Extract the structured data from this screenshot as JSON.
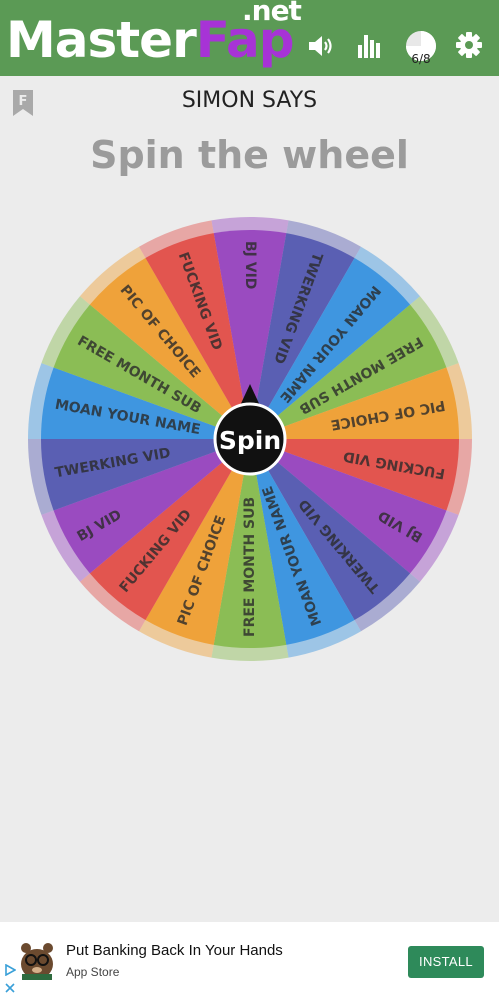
{
  "header": {
    "logo_master": "Master",
    "logo_fap": "Fap",
    "logo_net": ".net",
    "progress_label": "6/8",
    "icons": [
      "volume-icon",
      "bar-chart-icon",
      "progress-pie-icon",
      "gear-icon"
    ],
    "color": "#5b9a55"
  },
  "page": {
    "bookmark_letter": "F",
    "subtitle": "SIMON SAYS",
    "title": "Spin the wheel"
  },
  "wheel": {
    "center_label": "Spin",
    "segments": [
      "BJ VID",
      "TWERKING VID",
      "MOAN YOUR NAME",
      "FREE MONTH SUB",
      "PIC OF CHOICE",
      "FUCKING VID",
      "BJ VID",
      "TWERKING VID",
      "MOAN YOUR NAME",
      "FREE MONTH SUB",
      "PIC OF CHOICE",
      "FUCKING VID",
      "BJ VID",
      "TWERKING VID",
      "MOAN YOUR NAME",
      "FREE MONTH SUB",
      "PIC OF CHOICE",
      "FUCKING VID"
    ],
    "colors": [
      "#9a4bc0",
      "#5a5fb3",
      "#3f96e0",
      "#8bbd55",
      "#efa23a",
      "#e2554f"
    ]
  },
  "ad": {
    "title": "Put Banking Back In Your Hands",
    "source": "App Store",
    "button": "INSTALL"
  }
}
